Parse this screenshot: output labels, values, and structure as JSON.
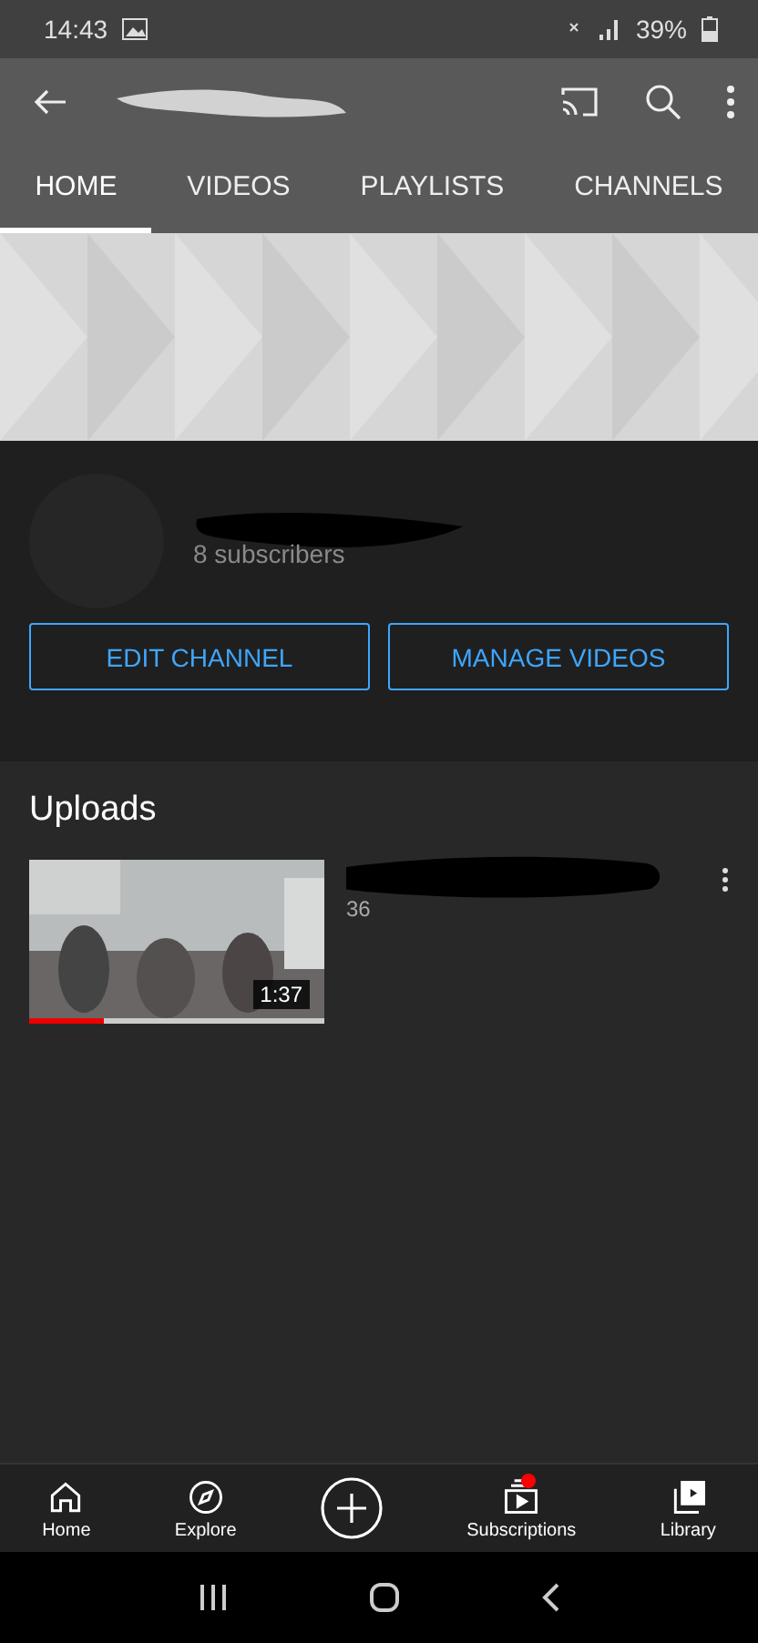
{
  "status_bar": {
    "time": "14:43",
    "battery": "39%"
  },
  "tabs": [
    {
      "label": "HOME",
      "selected": true
    },
    {
      "label": "VIDEOS",
      "selected": false
    },
    {
      "label": "PLAYLISTS",
      "selected": false
    },
    {
      "label": "CHANNELS",
      "selected": false
    }
  ],
  "channel": {
    "subscribers": "8 subscribers",
    "buttons": [
      "EDIT CHANNEL",
      "MANAGE VIDEOS"
    ]
  },
  "uploads": {
    "title": "Uploads",
    "videos": [
      {
        "duration": "1:37",
        "level": 0.25,
        "meta": "36"
      }
    ]
  },
  "bottom_nav": [
    {
      "label": "Home",
      "kind": "home",
      "badge": false
    },
    {
      "label": "Explore",
      "kind": "explore",
      "badge": false
    },
    {
      "kind": "create",
      "badge": false
    },
    {
      "label": "Subscriptions",
      "kind": "subscriptions",
      "badge": true
    },
    {
      "label": "Library",
      "kind": "library",
      "badge": false
    }
  ]
}
